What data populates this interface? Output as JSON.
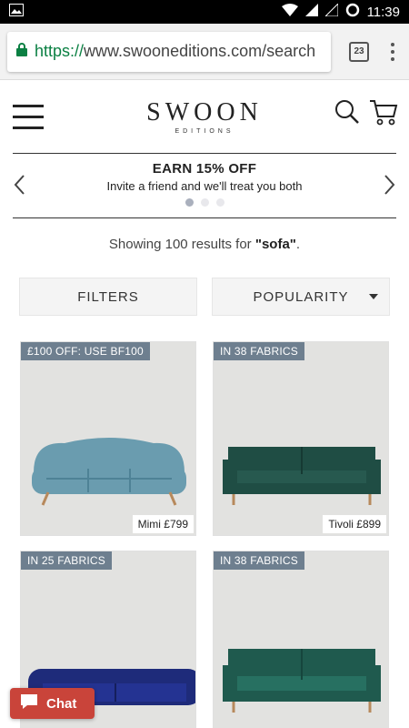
{
  "status_bar": {
    "time": "11:39"
  },
  "browser": {
    "url_scheme": "https://",
    "url_rest": "www.swooneditions.com/search",
    "tab_count": "23"
  },
  "header": {
    "logo_main": "SWOON",
    "logo_sub": "EDITIONS"
  },
  "promo": {
    "title": "EARN 15% OFF",
    "subtitle": "Invite a friend and we'll treat you both"
  },
  "results": {
    "prefix": "Showing 100 results for ",
    "query": "\"sofa\"",
    "suffix": "."
  },
  "controls": {
    "filters_label": "FILTERS",
    "sort_label": "POPULARITY"
  },
  "products": [
    {
      "badge": "£100 OFF: USE BF100",
      "price_label": "Mimi £799",
      "color": "#6a9caf"
    },
    {
      "badge": "IN 38 FABRICS",
      "price_label": "Tivoli £899",
      "color": "#1f4d44"
    },
    {
      "badge": "IN 25 FABRICS",
      "price_label": "",
      "color": "#1e2b7a"
    },
    {
      "badge": "IN 38 FABRICS",
      "price_label": "",
      "color": "#1f5a4e"
    }
  ],
  "chat": {
    "label": "Chat"
  },
  "colors": {
    "accent_red": "#c9443a",
    "badge_bg": "#6e7f8f",
    "url_green": "#0b8043"
  }
}
